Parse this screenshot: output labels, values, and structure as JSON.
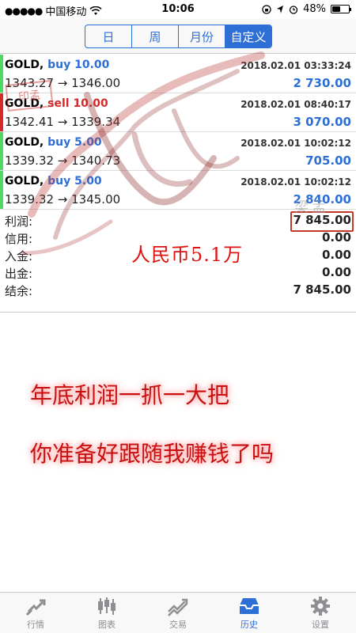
{
  "status_bar": {
    "carrier": "中国移动",
    "time": "10:06",
    "battery": "48%",
    "battery_level": 0.48
  },
  "segments": [
    {
      "label": "日",
      "active": false
    },
    {
      "label": "周",
      "active": false
    },
    {
      "label": "月份",
      "active": false
    },
    {
      "label": "自定义",
      "active": true
    }
  ],
  "trades": [
    {
      "symbol": "GOLD,",
      "direction": "buy 10.00",
      "side": "buy",
      "prices": "1343.27 → 1346.00",
      "time": "2018.02.01 03:33:24",
      "profit": "2 730.00"
    },
    {
      "symbol": "GOLD,",
      "direction": "sell 10.00",
      "side": "sell",
      "prices": "1342.41 → 1339.34",
      "time": "2018.02.01 08:40:17",
      "profit": "3 070.00"
    },
    {
      "symbol": "GOLD,",
      "direction": "buy 5.00",
      "side": "buy",
      "prices": "1339.32 → 1340.73",
      "time": "2018.02.01 10:02:12",
      "profit": "705.00"
    },
    {
      "symbol": "GOLD,",
      "direction": "buy 5.00",
      "side": "buy",
      "prices": "1339.32 → 1345.00",
      "time": "2018.02.01 10:02:12",
      "profit": "2 840.00"
    }
  ],
  "summary": [
    {
      "label": "利润:",
      "value": "7 845.00"
    },
    {
      "label": "信用:",
      "value": "0.00"
    },
    {
      "label": "入金:",
      "value": "0.00"
    },
    {
      "label": "出金:",
      "value": "0.00"
    },
    {
      "label": "结余:",
      "value": "7 845.00"
    }
  ],
  "overlays": {
    "rmb": "人民币5.1万",
    "line1": "年底利润一抓一大把",
    "line2": "你准备好跟随我赚钱了吗",
    "seal_text": "印孟",
    "watermark": "梁孟"
  },
  "tabs": [
    {
      "label": "行情",
      "icon": "quotes-icon",
      "active": false
    },
    {
      "label": "图表",
      "icon": "chart-icon",
      "active": false
    },
    {
      "label": "交易",
      "icon": "trade-icon",
      "active": false
    },
    {
      "label": "历史",
      "icon": "history-icon",
      "active": true
    },
    {
      "label": "设置",
      "icon": "settings-icon",
      "active": false
    }
  ],
  "colors": {
    "accent": "#2e6fd6",
    "buy_bar": "#4cd964",
    "sell_bar": "#d42a2a",
    "highlight_box": "#c0392b"
  }
}
